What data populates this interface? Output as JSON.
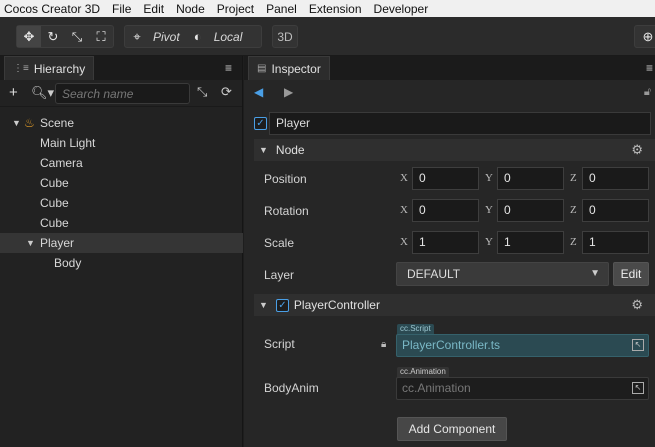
{
  "menubar": {
    "app_title": "Cocos Creator 3D",
    "items": [
      "File",
      "Edit",
      "Node",
      "Project",
      "Panel",
      "Extension",
      "Developer"
    ]
  },
  "toolbar": {
    "transform_tools": [
      "move-icon",
      "rotate-icon",
      "scale-icon",
      "rect-icon"
    ],
    "pivot_label": "Pivot",
    "local_label": "Local",
    "mode_3d_label": "3D"
  },
  "hierarchy": {
    "tab_label": "Hierarchy",
    "search_placeholder": "Search name",
    "nodes": [
      {
        "label": "Scene"
      },
      {
        "label": "Main Light"
      },
      {
        "label": "Camera"
      },
      {
        "label": "Cube"
      },
      {
        "label": "Cube"
      },
      {
        "label": "Cube"
      },
      {
        "label": "Player"
      },
      {
        "label": "Body"
      }
    ],
    "selected": "Player"
  },
  "inspector": {
    "tab_label": "Inspector",
    "node_name": "Player",
    "node_section": {
      "title": "Node",
      "position": {
        "label": "Position",
        "x": "0",
        "y": "0",
        "z": "0"
      },
      "rotation": {
        "label": "Rotation",
        "x": "0",
        "y": "0",
        "z": "0"
      },
      "scale": {
        "label": "Scale",
        "x": "1",
        "y": "1",
        "z": "1"
      },
      "layer": {
        "label": "Layer",
        "value": "DEFAULT",
        "edit_label": "Edit"
      },
      "axis_labels": {
        "x": "X",
        "y": "Y",
        "z": "Z"
      }
    },
    "component": {
      "title": "PlayerController",
      "script": {
        "label": "Script",
        "tag": "cc.Script",
        "value": "PlayerController.ts"
      },
      "body_anim": {
        "label": "BodyAnim",
        "tag": "cc.Animation",
        "value": "cc.Animation"
      }
    },
    "add_component_label": "Add Component"
  },
  "colors": {
    "accent": "#4a9fe6",
    "background": "#1e1e1e",
    "script_slot": "#2b4a52"
  }
}
